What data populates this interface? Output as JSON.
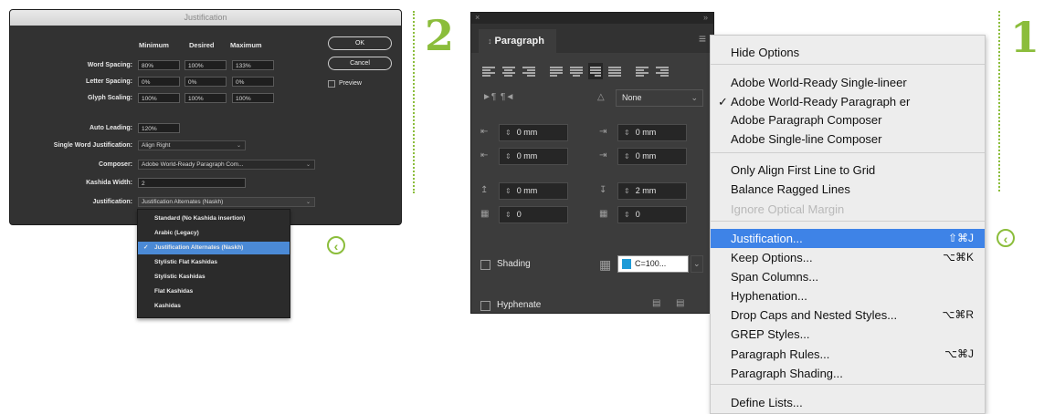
{
  "step_markers": {
    "left": "2",
    "right": "1"
  },
  "justification_dialog": {
    "title": "Justification",
    "column_headers": [
      "Minimum",
      "Desired",
      "Maximum"
    ],
    "rows": [
      {
        "label": "Word Spacing:",
        "values": [
          "80%",
          "100%",
          "133%"
        ]
      },
      {
        "label": "Letter Spacing:",
        "values": [
          "0%",
          "0%",
          "0%"
        ]
      },
      {
        "label": "Glyph Scaling:",
        "values": [
          "100%",
          "100%",
          "100%"
        ]
      }
    ],
    "auto_leading_label": "Auto Leading:",
    "auto_leading_value": "120%",
    "single_word_label": "Single Word Justification:",
    "single_word_value": "Align Right",
    "composer_label": "Composer:",
    "composer_value": "Adobe World-Ready Paragraph Com...",
    "kashida_label": "Kashida Width:",
    "kashida_value": "2",
    "justification_label": "Justification:",
    "justification_value": "Justification Alternates (Naskh)",
    "ok_label": "OK",
    "cancel_label": "Cancel",
    "preview_label": "Preview",
    "dropdown_options": [
      "Standard (No Kashida insertion)",
      "Arabic (Legacy)",
      "Justification Alternates (Naskh)",
      "Stylistic Flat Kashidas",
      "Stylistic Kashidas",
      "Flat Kashidas",
      "Kashidas"
    ],
    "dropdown_selected_index": 2
  },
  "paragraph_panel": {
    "tab_label": "Paragraph",
    "tab_glyph": "↕",
    "menu_glyph": "≡",
    "close_glyph": "×",
    "collapse_glyph": "»",
    "direction_value": "None",
    "left_indent": "0 mm",
    "right_indent": "0 mm",
    "first_line_indent": "0 mm",
    "last_line_indent": "0 mm",
    "space_before": "0 mm",
    "space_after": "2 mm",
    "drop_cap_lines": "0",
    "drop_cap_chars": "0",
    "shading_label": "Shading",
    "shading_color": "C=100...",
    "shading_swatch": "#1e9bd7",
    "hyphenate_label": "Hyphenate"
  },
  "flyout_menu": {
    "items": [
      {
        "label": "Hide Options",
        "shortcut": "",
        "checked": false,
        "disabled": false,
        "highlight": false
      },
      {
        "sep": true
      },
      {
        "label": "Adobe World-Ready Single-lineеr",
        "shortcut": "",
        "checked": false,
        "disabled": false,
        "highlight": false
      },
      {
        "label": "Adobe World-Ready Paragraph er",
        "shortcut": "",
        "checked": true,
        "disabled": false,
        "highlight": false
      },
      {
        "label": "Adobe Paragraph Composer",
        "shortcut": "",
        "checked": false,
        "disabled": false,
        "highlight": false
      },
      {
        "label": "Adobe Single-line Composer",
        "shortcut": "",
        "checked": false,
        "disabled": false,
        "highlight": false
      },
      {
        "sep": true
      },
      {
        "label": "Only Align First Line to Grid",
        "shortcut": "",
        "checked": false,
        "disabled": false,
        "highlight": false
      },
      {
        "label": "Balance Ragged Lines",
        "shortcut": "",
        "checked": false,
        "disabled": false,
        "highlight": false
      },
      {
        "label": "Ignore Optical Margin",
        "shortcut": "",
        "checked": false,
        "disabled": true,
        "highlight": false
      },
      {
        "sep": true
      },
      {
        "label": "Justification...",
        "shortcut": "⇧⌘J",
        "checked": false,
        "disabled": false,
        "highlight": true
      },
      {
        "label": "Keep Options...",
        "shortcut": "⌥⌘K",
        "checked": false,
        "disabled": false,
        "highlight": false
      },
      {
        "label": "Span Columns...",
        "shortcut": "",
        "checked": false,
        "disabled": false,
        "highlight": false
      },
      {
        "label": "Hyphenation...",
        "shortcut": "",
        "checked": false,
        "disabled": false,
        "highlight": false
      },
      {
        "label": "Drop Caps and Nested Styles...",
        "shortcut": "⌥⌘R",
        "checked": false,
        "disabled": false,
        "highlight": false
      },
      {
        "label": "GREP Styles...",
        "shortcut": "",
        "checked": false,
        "disabled": false,
        "highlight": false
      },
      {
        "label": "Paragraph Rules...",
        "shortcut": "⌥⌘J",
        "checked": false,
        "disabled": false,
        "highlight": false
      },
      {
        "label": "Paragraph Shading...",
        "shortcut": "",
        "checked": false,
        "disabled": false,
        "highlight": false
      },
      {
        "sep": true
      },
      {
        "label": "Define Lists...",
        "shortcut": "",
        "checked": false,
        "disabled": false,
        "highlight": false
      }
    ]
  },
  "colors": {
    "accent_green": "#8bbd3b",
    "highlight_blue": "#3e83e7",
    "dialog_bg": "#323232"
  }
}
